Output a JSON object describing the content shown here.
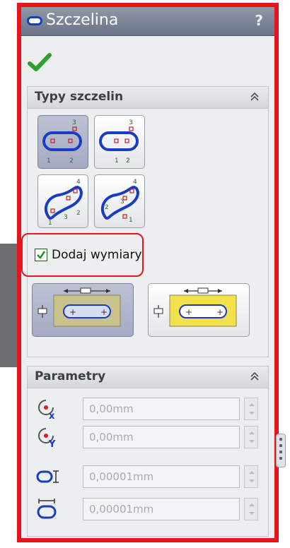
{
  "panel": {
    "title": "Szczelina",
    "help_label": "?"
  },
  "slot_types_group": {
    "title": "Typy szczelin",
    "buttons": [
      {
        "name": "straight-slot",
        "selected": true
      },
      {
        "name": "center-straight-slot",
        "selected": false
      },
      {
        "name": "3-point-arc-slot",
        "selected": false
      },
      {
        "name": "center-arc-slot",
        "selected": false
      }
    ],
    "add_dimensions": {
      "label": "Dodaj wymiary",
      "checked": true
    },
    "dimension_options": [
      {
        "name": "overall-length-dimension",
        "selected": true
      },
      {
        "name": "center-to-center-dimension",
        "selected": false
      }
    ]
  },
  "parameters_group": {
    "title": "Parametry",
    "fields": [
      {
        "name": "center-x",
        "value": "0,00mm"
      },
      {
        "name": "center-y",
        "value": "0,00mm"
      },
      {
        "name": "slot-width",
        "value": "0,00001mm"
      },
      {
        "name": "slot-length",
        "value": "0,00001mm"
      }
    ]
  },
  "colors": {
    "accent_red": "#e8141c",
    "title_bar": "#7c8499",
    "slot_blue": "#1a3cc3",
    "check_green": "#2ea02e"
  }
}
